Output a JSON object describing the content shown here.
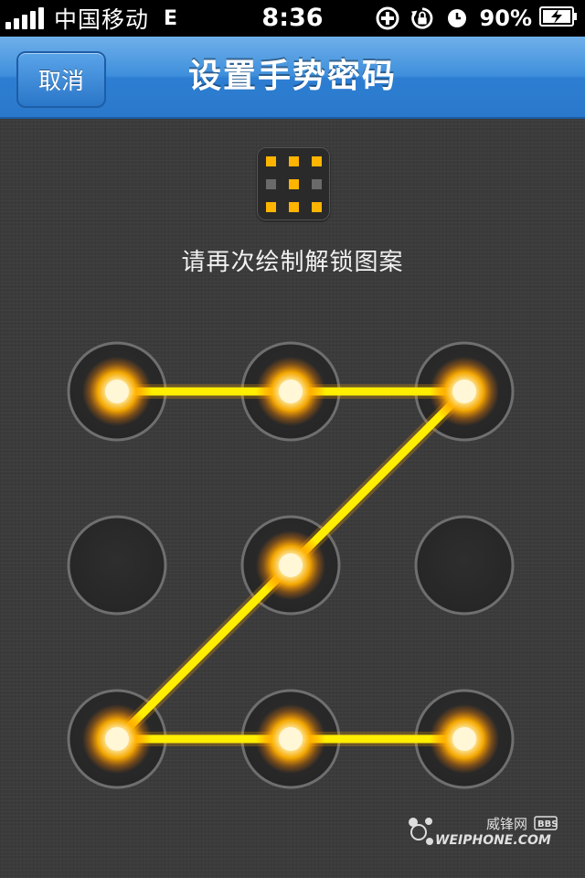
{
  "status_bar": {
    "carrier": "中国移动",
    "network": "E",
    "time": "8:36",
    "battery_percent": "90%",
    "icons": [
      "signal-bars-icon",
      "location-plus-icon",
      "rotation-lock-icon",
      "alarm-clock-icon",
      "battery-charging-icon"
    ]
  },
  "nav": {
    "cancel_label": "取消",
    "title": "设置手势密码"
  },
  "pattern_preview": {
    "grid": [
      [
        1,
        1,
        1
      ],
      [
        0,
        1,
        0
      ],
      [
        1,
        1,
        1
      ]
    ],
    "on_color": "#ffb400",
    "off_color": "#6a6a6a"
  },
  "prompt": "请再次绘制解锁图案",
  "lock_pattern": {
    "nodes_selected": [
      1,
      1,
      1,
      0,
      1,
      0,
      1,
      1,
      1
    ],
    "path_order": [
      0,
      1,
      2,
      4,
      6,
      7,
      8
    ],
    "line_color": "#ffee00",
    "glow_color": "#ffaa00"
  },
  "watermark": {
    "cn": "威锋网",
    "bbs": "BBS",
    "en": "WEIPHONE.COM"
  }
}
